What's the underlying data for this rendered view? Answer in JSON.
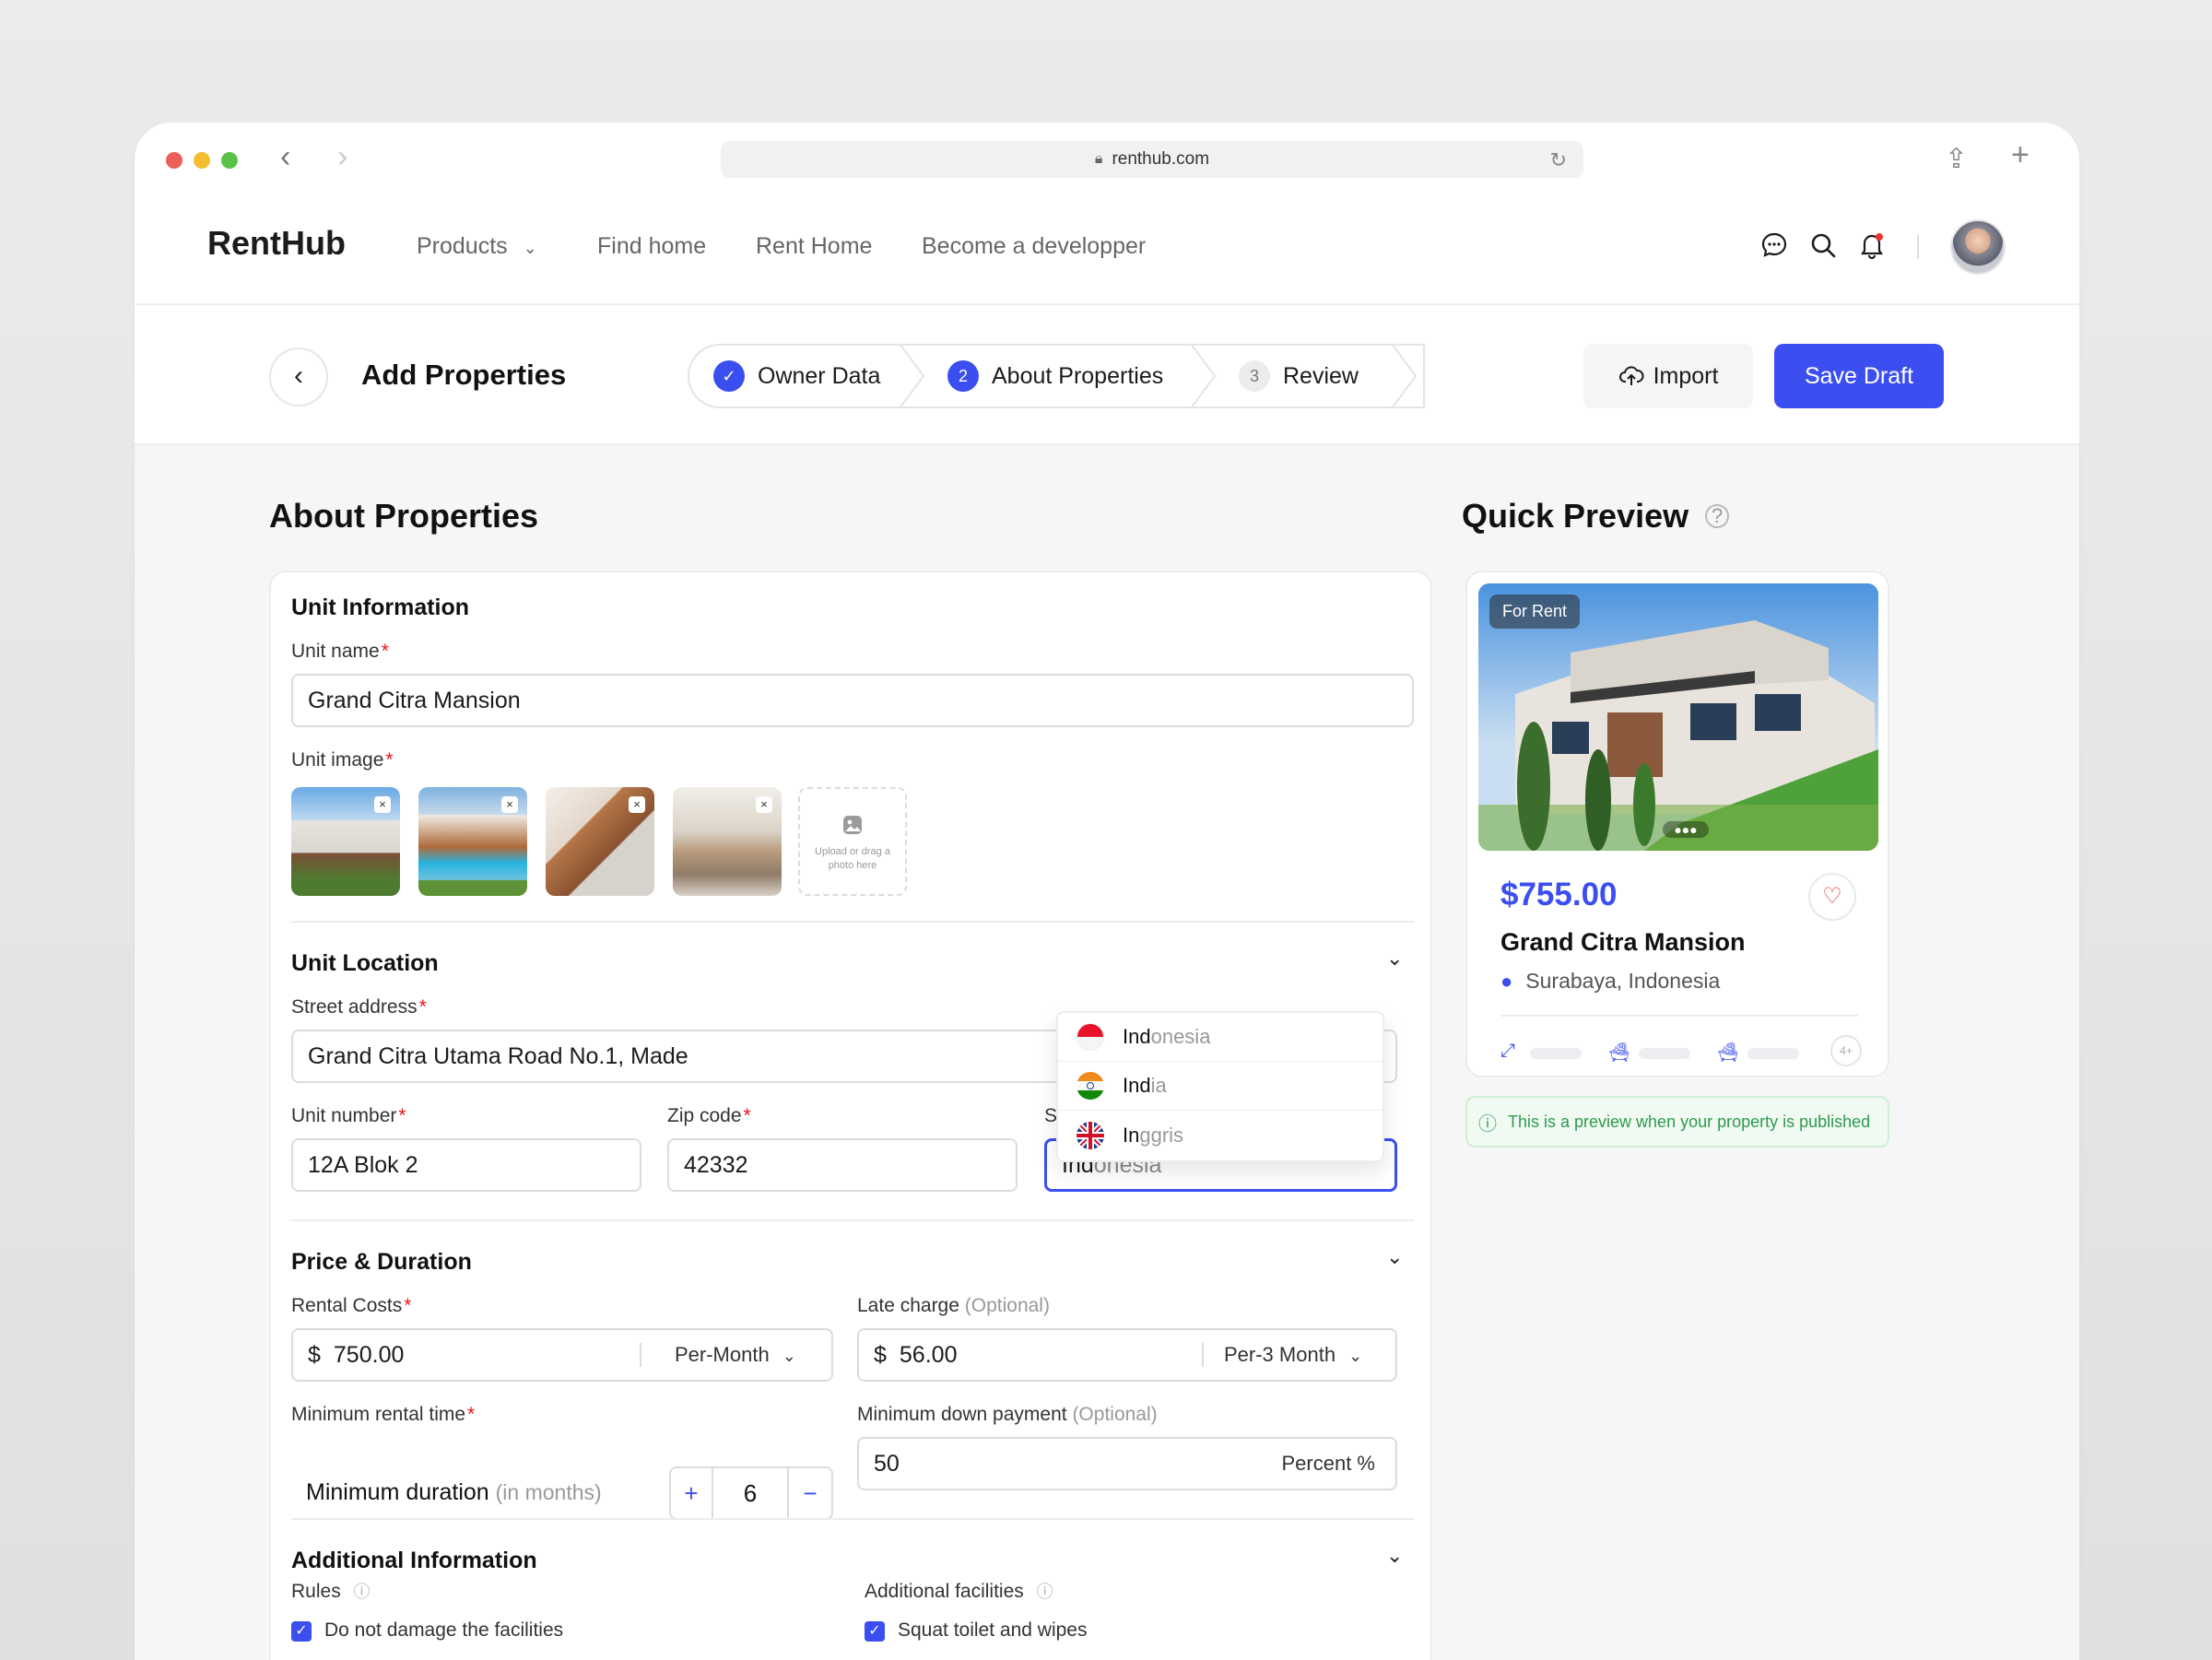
{
  "browser": {
    "url": "renthub.com"
  },
  "nav": {
    "logo": "RentHub",
    "items": [
      "Products",
      "Find home",
      "Rent Home",
      "Become a developper"
    ]
  },
  "header": {
    "title": "Add Properties",
    "steps": [
      {
        "num": "✓",
        "label": "Owner Data",
        "state": "done"
      },
      {
        "num": "2",
        "label": "About Properties",
        "state": "active"
      },
      {
        "num": "3",
        "label": "Review",
        "state": "pending"
      }
    ],
    "import_label": "Import",
    "save_label": "Save Draft"
  },
  "form": {
    "heading": "About Properties",
    "unit_info": {
      "title": "Unit Information",
      "name_label": "Unit name",
      "name_value": "Grand Citra Mansion",
      "image_label": "Unit image",
      "upload_text": "Upload or drag a photo here"
    },
    "location": {
      "title": "Unit Location",
      "street_label": "Street address",
      "street_value": "Grand Citra Utama Road No.1, Made",
      "unit_label": "Unit number",
      "unit_value": "12A Blok 2",
      "zip_label": "Zip code",
      "zip_value": "42332",
      "state_label": "State",
      "state_typed": "Ind",
      "state_suggest": "onesia",
      "options": [
        {
          "match": "Ind",
          "rest": "onesia",
          "flag": "indonesia"
        },
        {
          "match": "Ind",
          "rest": "ia",
          "flag": "india"
        },
        {
          "match": "In",
          "rest": "ggris",
          "flag": "uk"
        }
      ]
    },
    "price": {
      "title": "Price & Duration",
      "rental_label": "Rental Costs",
      "currency": "$",
      "rental_value": "750.00",
      "rental_period": "Per-Month",
      "late_label": "Late charge",
      "optional": "(Optional)",
      "late_value": "56.00",
      "late_period": "Per-3 Month",
      "min_time_label": "Minimum rental time",
      "min_duration": "Minimum duration",
      "min_duration_unit": "(in months)",
      "min_value": "6",
      "down_label": "Minimum down payment",
      "down_value": "50",
      "down_unit": "Percent %"
    },
    "additional": {
      "title": "Additional Information",
      "rules_label": "Rules",
      "rule_1": "Do not damage the facilities",
      "facilities_label": "Additional facilities",
      "facility_1": "Squat toilet and wipes"
    }
  },
  "preview": {
    "heading": "Quick Preview",
    "badge": "For Rent",
    "price": "$755.00",
    "name": "Grand Citra Mansion",
    "location": "Surabaya, Indonesia",
    "more": "4+",
    "note": "This is a preview when your property is published"
  },
  "colors": {
    "accent": "#3b4ef0",
    "required": "#e11111",
    "success": "#2f9a4b"
  }
}
